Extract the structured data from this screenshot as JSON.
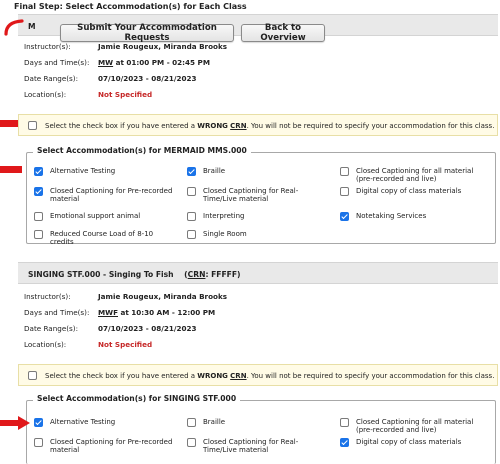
{
  "page_title": "Final Step: Select Accommodation(s) for Each Class",
  "top_buttons": {
    "submit": "Submit Your Accommodation Requests",
    "back": "Back to Overview"
  },
  "class1": {
    "title_visible": "M",
    "instructor_label": "Instructor(s):",
    "instructor_value": "Jamie Rougeux, Miranda Brooks",
    "days_label": "Days and Time(s):",
    "days_underlined": "MW",
    "days_rest": " at 01:00 PM - 02:45 PM",
    "date_label": "Date Range(s):",
    "date_value": "07/10/2023 - 08/21/2023",
    "location_label": "Location(s):",
    "location_value": "Not Specified",
    "notice_pre": "Select the check box if you have entered a ",
    "notice_bold": "WRONG",
    "notice_crn": "CRN",
    "notice_post": ". You will not be required to specify your accommodation for this class.",
    "legend": "Select Accommodation(s) for MERMAID MMS.000",
    "options": [
      {
        "label": "Alternative Testing",
        "checked": true
      },
      {
        "label": "Braille",
        "checked": true
      },
      {
        "label": "Closed Captioning for all material (pre-recorded and live)",
        "checked": false
      },
      {
        "label": "Closed Captioning for Pre-recorded material",
        "checked": true
      },
      {
        "label": "Closed Captioning for Real-Time/Live material",
        "checked": false
      },
      {
        "label": "Digital copy of class materials",
        "checked": false
      },
      {
        "label": "Emotional support animal",
        "checked": false
      },
      {
        "label": "Interpreting",
        "checked": false
      },
      {
        "label": "Notetaking Services",
        "checked": true
      },
      {
        "label": "Reduced Course Load of 8-10 credits",
        "checked": false
      },
      {
        "label": "Single Room",
        "checked": false
      }
    ]
  },
  "class2": {
    "title": "SINGING STF.000 - Singing To Fish",
    "crn_open": "(",
    "crn_label": "CRN",
    "crn_value": ": FFFFF)",
    "instructor_label": "Instructor(s):",
    "instructor_value": "Jamie Rougeux, Miranda Brooks",
    "days_label": "Days and Time(s):",
    "days_underlined": "MWF",
    "days_rest": " at 10:30 AM - 12:00 PM",
    "date_label": "Date Range(s):",
    "date_value": "07/10/2023 - 08/21/2023",
    "location_label": "Location(s):",
    "location_value": "Not Specified",
    "notice_pre": "Select the check box if you have entered a ",
    "notice_bold": "WRONG",
    "notice_crn": "CRN",
    "notice_post": ". You will not be required to specify your accommodation for this class.",
    "legend": "Select Accommodation(s) for SINGING STF.000",
    "options": [
      {
        "label": "Alternative Testing",
        "checked": true
      },
      {
        "label": "Braille",
        "checked": false
      },
      {
        "label": "Closed Captioning for all material (pre-recorded and live)",
        "checked": false
      },
      {
        "label": "Closed Captioning for Pre-recorded material",
        "checked": false
      },
      {
        "label": "Closed Captioning for Real-Time/Live material",
        "checked": false
      },
      {
        "label": "Digital copy of class materials",
        "checked": true
      }
    ]
  },
  "colors": {
    "accent": "#1a73e8",
    "warning_red": "#c62828",
    "annotation_red": "#e0181a",
    "notice_bg": "#fffbe6"
  }
}
